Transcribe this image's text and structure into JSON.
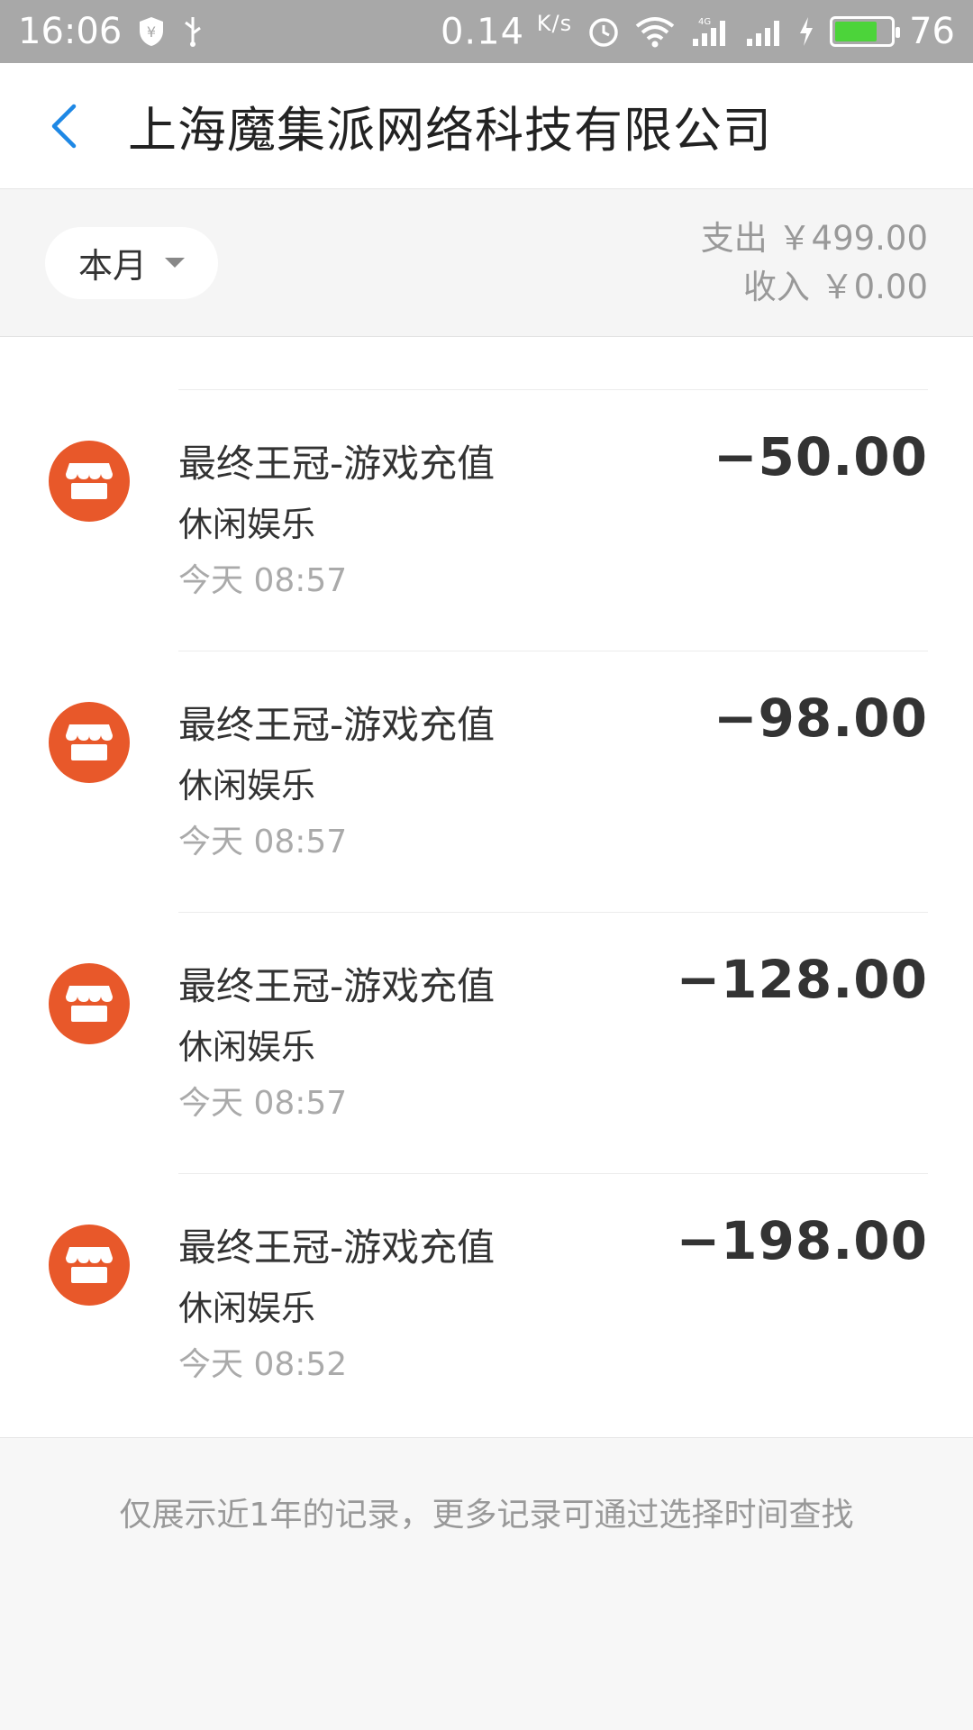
{
  "status_bar": {
    "time": "16:06",
    "net_speed": "0.14",
    "net_unit": "K/s",
    "battery": "76",
    "battery_level_percent": 76,
    "icons": [
      "shield-icon",
      "usb-icon",
      "alarm-icon",
      "wifi-icon",
      "signal-4g-icon",
      "signal-icon",
      "charging-icon",
      "battery-icon"
    ]
  },
  "header": {
    "title": "上海魔集派网络科技有限公司"
  },
  "summary": {
    "period": "本月",
    "expense": "支出 ￥499.00",
    "income": "收入 ￥0.00"
  },
  "transactions": [
    {
      "title": "最终王冠-游戏充值",
      "category": "休闲娱乐",
      "time": "今天  08:57",
      "amount": "−50.00",
      "icon": "store-icon"
    },
    {
      "title": "最终王冠-游戏充值",
      "category": "休闲娱乐",
      "time": "今天  08:57",
      "amount": "−98.00",
      "icon": "store-icon"
    },
    {
      "title": "最终王冠-游戏充值",
      "category": "休闲娱乐",
      "time": "今天  08:57",
      "amount": "−128.00",
      "icon": "store-icon"
    },
    {
      "title": "最终王冠-游戏充值",
      "category": "休闲娱乐",
      "time": "今天  08:52",
      "amount": "−198.00",
      "icon": "store-icon"
    }
  ],
  "footer": {
    "note": "仅展示近1年的记录，更多记录可通过选择时间查找"
  },
  "colors": {
    "accent": "#1e88e5",
    "store_icon_bg": "#e8582a",
    "status_bar_bg": "#a8a8a8",
    "battery_fill": "#4cd43a"
  }
}
